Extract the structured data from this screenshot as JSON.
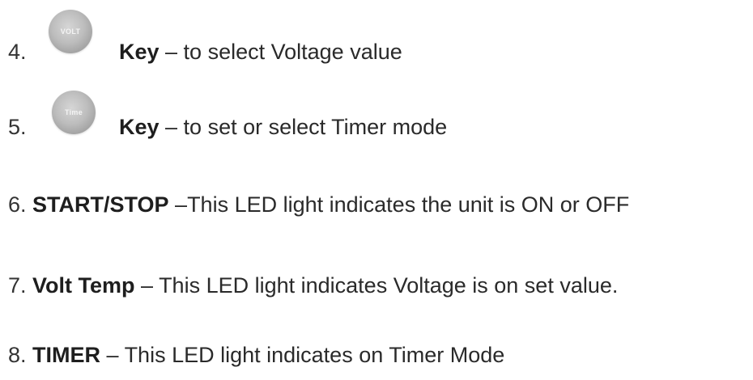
{
  "items": [
    {
      "number": "4.",
      "icon_name": "volt-key-icon",
      "icon_label": "VOLT",
      "bold": "Key",
      "text": " – to select Voltage value"
    },
    {
      "number": "5.",
      "icon_name": "timer-key-icon",
      "icon_label": "Time",
      "bold": "Key",
      "text": " – to set or select Timer mode"
    },
    {
      "number": "6.",
      "bold": "START/STOP",
      "text": " –This LED light indicates the unit is ON or OFF"
    },
    {
      "number": "7.",
      "bold": "Volt Temp",
      "text": " – This LED light indicates Voltage is on set value."
    },
    {
      "number": "8.",
      "bold": "TIMER",
      "text": " – This LED light indicates on Timer Mode"
    }
  ]
}
